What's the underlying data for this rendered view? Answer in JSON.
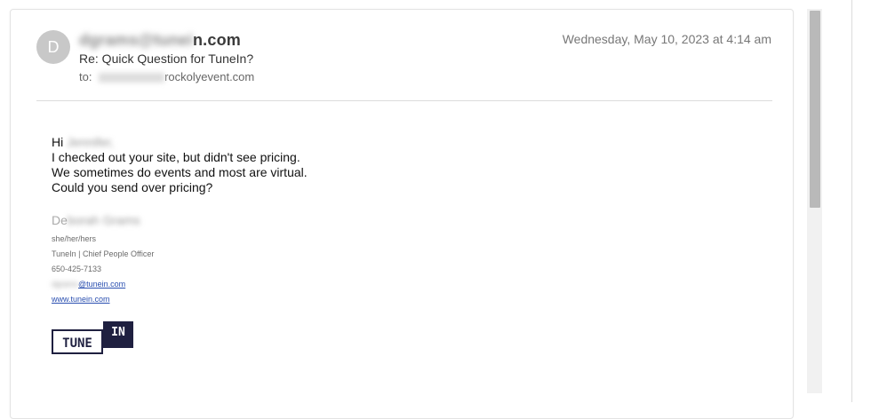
{
  "email": {
    "avatar_letter": "D",
    "sender_blurred": "dgrams@tunei",
    "sender_visible": "n.com",
    "subject": "Re: Quick Question for TuneIn?",
    "to_label": "to:",
    "to_blurred_part": "jennifer",
    "to_visible": "rockolyevent.com",
    "date": "Wednesday, May 10, 2023 at 4:14 am"
  },
  "body": {
    "greeting": "Hi",
    "greeting_name_blurred": "Jennifer,",
    "line1": "I checked out your site, but didn't see pricing.",
    "line2": "We sometimes do events and most are virtual.",
    "line3": "Could you send over pricing?"
  },
  "signature": {
    "name_prefix": "De",
    "name_blurred": "borah Grams",
    "pronouns": "she/her/hers",
    "title": "TuneIn | Chief People Officer",
    "phone": "650-425-7133",
    "email_blurred": "dgrams",
    "email_visible": "@tunein.com",
    "website": "www.tunein.com"
  },
  "logo": {
    "left_text": "TUNE",
    "right_text": "IN"
  }
}
